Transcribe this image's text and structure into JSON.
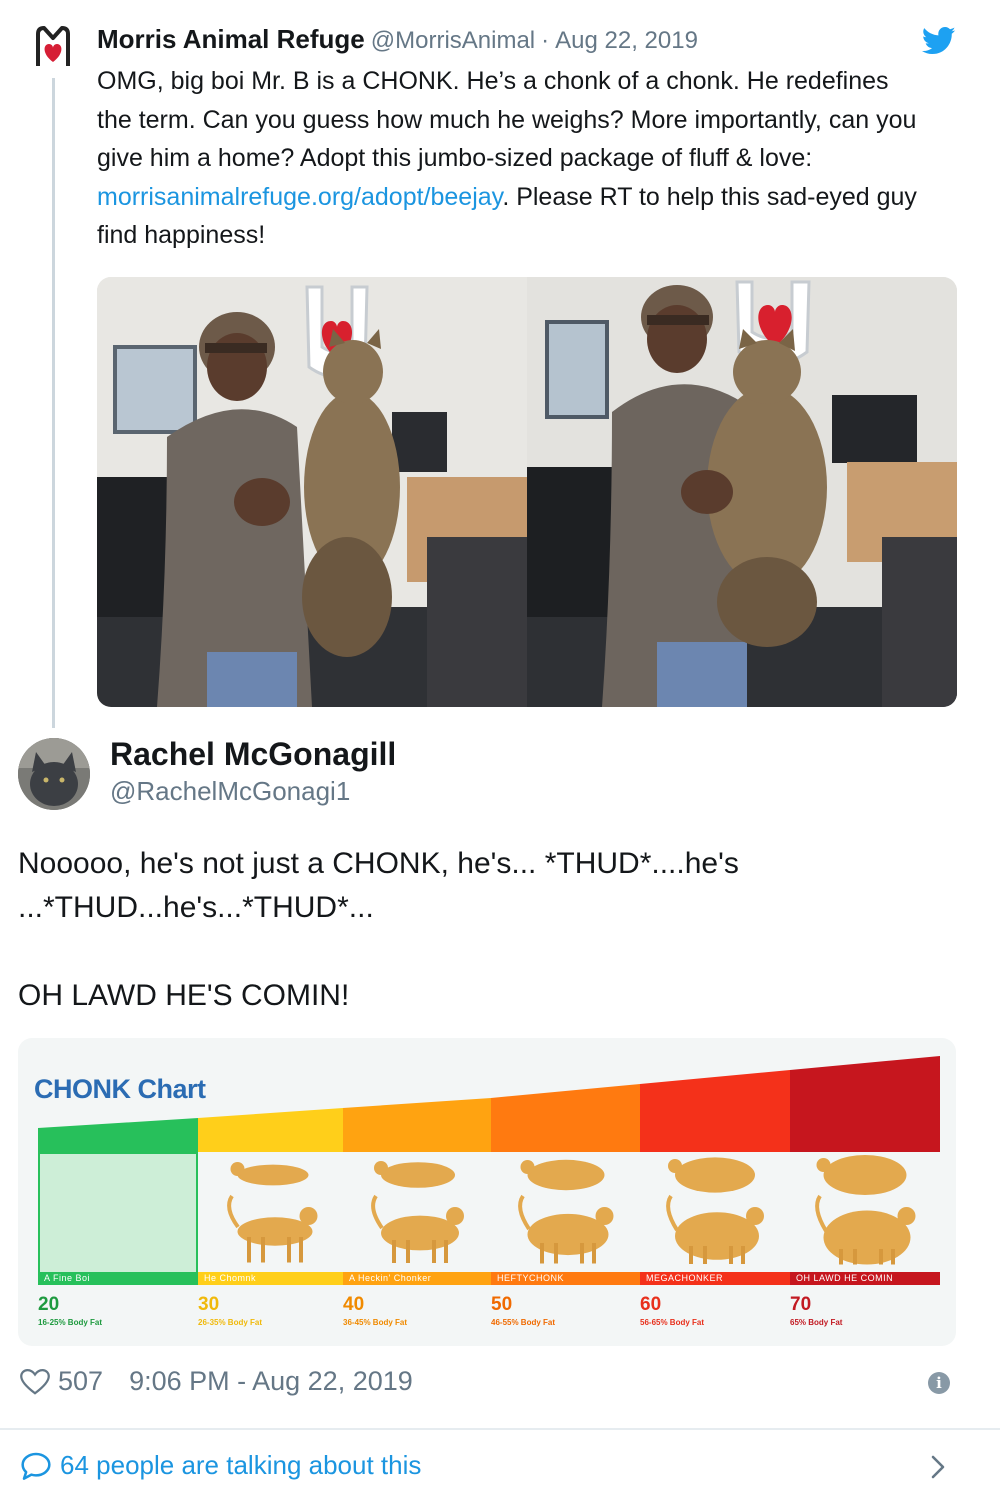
{
  "parent_tweet": {
    "name": "Morris Animal Refuge",
    "handle": "@MorrisAnimal",
    "separator": "·",
    "date": "Aug 22, 2019",
    "text_before_link": "OMG, big boi Mr. B is a CHONK. He’s a chonk of a chonk. He redefines the term. Can you guess how much he weighs? More importantly, can you give him a home? Adopt this jumbo-sized package of fluff & love: ",
    "link": "morrisanimalrefuge.org/adopt/beejay",
    "text_after_link": ". Please RT to help this sad-eyed guy find happiness!",
    "logo_icon": "morris-heart-logo",
    "brand_icon": "twitter-bird-icon"
  },
  "reply_tweet": {
    "name": "Rachel McGonagill",
    "handle": "@RachelMcGonagi1",
    "line1": "Nooooo, he's not just a CHONK, he's... *THUD*....he's",
    "line2": "...*THUD...he's...*THUD*...",
    "line3": "OH LAWD HE'S COMIN!"
  },
  "chonk_chart": {
    "title": "CHONK Chart",
    "levels": [
      {
        "value": "20",
        "fat": "16-25% Body Fat",
        "label": "A Fine Boi",
        "color": "#27c05b",
        "value_color": "#1e9a3f"
      },
      {
        "value": "30",
        "fat": "26-35% Body Fat",
        "label": "He Chomnk",
        "color": "#ffcf1a",
        "value_color": "#f0b90b"
      },
      {
        "value": "40",
        "fat": "36-45% Body Fat",
        "label": "A Heckin' Chonker",
        "color": "#ffa311",
        "value_color": "#f08a00"
      },
      {
        "value": "50",
        "fat": "46-55% Body Fat",
        "label": "HEFTYCHONK",
        "color": "#ff7a10",
        "value_color": "#f06a00"
      },
      {
        "value": "60",
        "fat": "56-65% Body Fat",
        "label": "MEGACHONKER",
        "color": "#f4311a",
        "value_color": "#e8301c"
      },
      {
        "value": "70",
        "fat": "65% Body Fat",
        "label": "OH LAWD HE COMIN",
        "color": "#c6161e",
        "value_color": "#c21a22"
      }
    ]
  },
  "footer": {
    "likes": "507",
    "timestamp": "9:06 PM - Aug 22, 2019",
    "talking": "64 people are talking about this"
  }
}
